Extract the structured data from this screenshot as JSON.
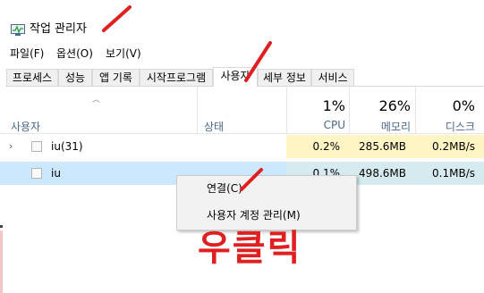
{
  "window": {
    "title": "작업 관리자",
    "app_icon": "task-manager-icon"
  },
  "menu": [
    "파일(F)",
    "옵션(O)",
    "보기(V)"
  ],
  "tabs": [
    {
      "label": "프로세스",
      "active": false
    },
    {
      "label": "성능",
      "active": false
    },
    {
      "label": "앱 기록",
      "active": false
    },
    {
      "label": "시작프로그램",
      "active": false
    },
    {
      "label": "사용자",
      "active": true
    },
    {
      "label": "세부 정보",
      "active": false
    },
    {
      "label": "서비스",
      "active": false
    }
  ],
  "columns": {
    "name": "사용자",
    "status": "상태",
    "cpu": {
      "pct": "1%",
      "label": "CPU"
    },
    "memory": {
      "pct": "26%",
      "label": "메모리"
    },
    "disk": {
      "pct": "0%",
      "label": "디스크"
    }
  },
  "rows": [
    {
      "name": "iu(31)",
      "cpu": "0.2%",
      "memory": "285.6MB",
      "disk": "0.2MB/s",
      "expandable": true,
      "selected": false
    },
    {
      "name": "iu",
      "cpu": "0.1%",
      "memory": "498.6MB",
      "disk": "0.1MB/s",
      "expandable": false,
      "selected": true
    }
  ],
  "context_menu": {
    "items": [
      "연결(C)",
      "사용자 계정 관리(M)"
    ]
  },
  "annotation": {
    "text": "우클릭",
    "color": "#e02020"
  },
  "colors": {
    "selection": "#cce8ff",
    "heat_light": "#fff4c4",
    "header_text": "#4b6887",
    "annotation": "#e02020"
  }
}
